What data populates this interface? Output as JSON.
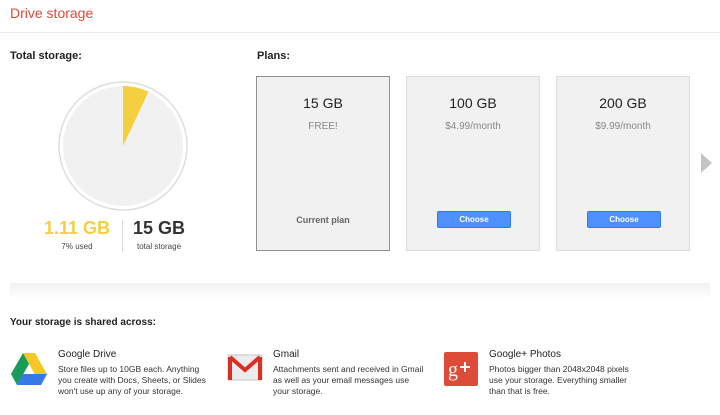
{
  "page": {
    "title": "Drive storage"
  },
  "total_storage": {
    "label": "Total storage:",
    "used_amount": "1.11 GB",
    "used_label": "7% used",
    "used_fraction": 0.07,
    "total_amount": "15 GB",
    "total_label": "total storage",
    "used_color": "#f4cf40"
  },
  "plans": {
    "label": "Plans:",
    "items": [
      {
        "size": "15 GB",
        "price": "FREE!",
        "action": "Current plan"
      },
      {
        "size": "100 GB",
        "price": "$4.99/month",
        "action": "Choose"
      },
      {
        "size": "200 GB",
        "price": "$9.99/month",
        "action": "Choose"
      }
    ],
    "next_icon": "chevron-right-icon"
  },
  "shared": {
    "label": "Your storage is shared across:",
    "services": [
      {
        "name": "Google Drive",
        "icon": "google-drive-icon",
        "lines": [
          "Store files up to 10GB each. Anything",
          "you create with Docs, Sheets, or Slides",
          "won't use up any of your storage."
        ]
      },
      {
        "name": "Gmail",
        "icon": "gmail-icon",
        "lines": [
          "Attachments sent and received in Gmail",
          "as well as your email messages use",
          "your storage."
        ]
      },
      {
        "name": "Google+ Photos",
        "icon": "google-plus-icon",
        "lines": [
          "Photos bigger than 2048x2048 pixels",
          "use your storage. Everything smaller",
          "than that is free."
        ]
      }
    ]
  },
  "colors": {
    "accent": "#dd4b39",
    "button": "#4d90fe"
  }
}
